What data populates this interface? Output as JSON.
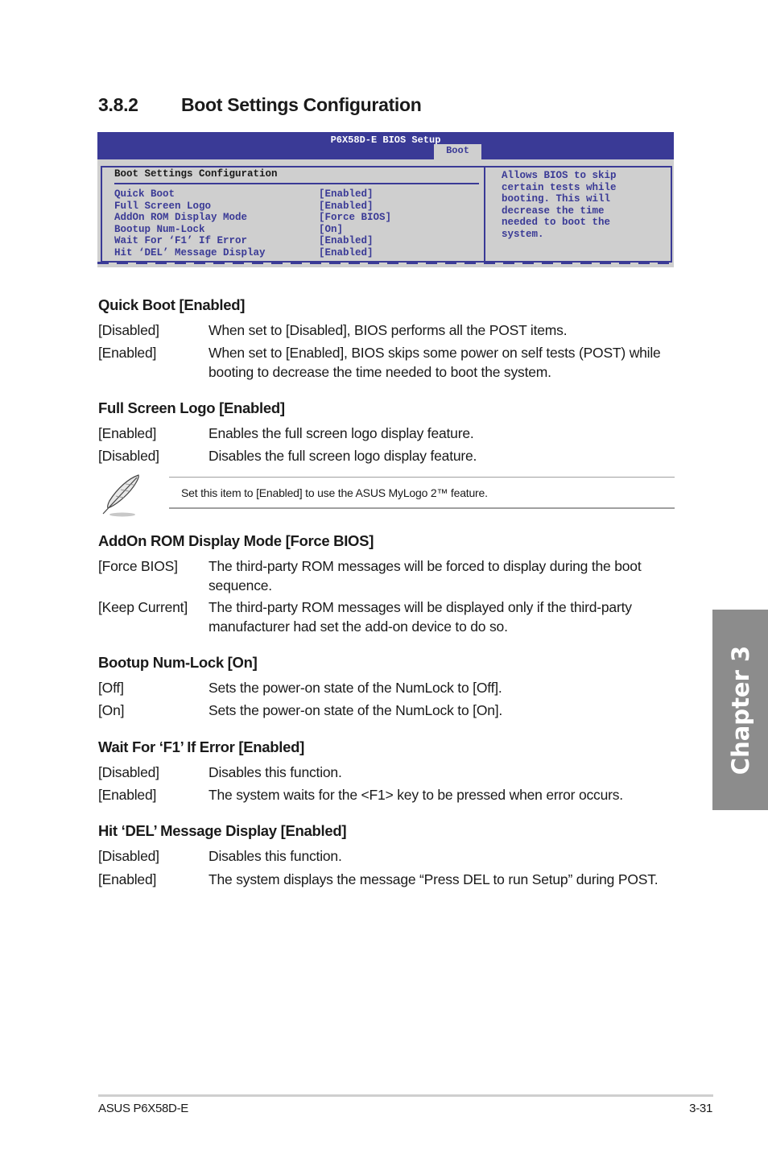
{
  "section": {
    "number": "3.8.2",
    "title": "Boot Settings Configuration"
  },
  "bios": {
    "title": "P6X58D-E BIOS Setup",
    "active_tab": "Boot",
    "panel_title": "Boot Settings Configuration",
    "items": [
      {
        "label": "Quick Boot",
        "value": "[Enabled]"
      },
      {
        "label": "Full Screen Logo",
        "value": "[Enabled]"
      },
      {
        "label": "AddOn ROM Display Mode",
        "value": "[Force BIOS]"
      },
      {
        "label": "Bootup Num-Lock",
        "value": "[On]"
      },
      {
        "label": "Wait For ‘F1’ If Error",
        "value": "[Enabled]"
      },
      {
        "label": "Hit ‘DEL’ Message Display",
        "value": "[Enabled]"
      }
    ],
    "help_lines": [
      "Allows BIOS to skip",
      "certain tests while",
      "booting. This will",
      "decrease the time",
      "needed to boot the",
      "system."
    ]
  },
  "descriptions": [
    {
      "heading": "Quick Boot [Enabled]",
      "options": [
        {
          "opt": "[Disabled]",
          "desc": "When set to [Disabled], BIOS performs all the POST items."
        },
        {
          "opt": "[Enabled]",
          "desc": "When set to [Enabled], BIOS skips some power on self tests (POST) while booting to decrease the time needed to boot the system."
        }
      ]
    },
    {
      "heading": "Full Screen Logo [Enabled]",
      "options": [
        {
          "opt": "[Enabled]",
          "desc": "Enables the full screen logo display feature."
        },
        {
          "opt": "[Disabled]",
          "desc": "Disables the full screen logo display feature."
        }
      ]
    },
    {
      "heading": "AddOn ROM Display Mode [Force BIOS]",
      "options": [
        {
          "opt": "[Force BIOS]",
          "desc": "The third-party ROM messages will be forced to display during the boot sequence."
        },
        {
          "opt": "[Keep Current]",
          "desc": "The third-party ROM messages will be displayed only if the third-party manufacturer had set the add-on device to do so."
        }
      ]
    },
    {
      "heading": "Bootup Num-Lock [On]",
      "options": [
        {
          "opt": "[Off]",
          "desc": "Sets the power-on state of the NumLock to [Off]."
        },
        {
          "opt": "[On]",
          "desc": "Sets the power-on state of the NumLock to [On]."
        }
      ]
    },
    {
      "heading": "Wait For ‘F1’ If Error [Enabled]",
      "options": [
        {
          "opt": "[Disabled]",
          "desc": "Disables this function."
        },
        {
          "opt": "[Enabled]",
          "desc": "The system waits for the <F1> key to be pressed when error occurs."
        }
      ]
    },
    {
      "heading": "Hit ‘DEL’ Message Display [Enabled]",
      "options": [
        {
          "opt": "[Disabled]",
          "desc": "Disables this function."
        },
        {
          "opt": "[Enabled]",
          "desc": "The system displays the message “Press DEL to run Setup” during POST."
        }
      ]
    }
  ],
  "note": {
    "icon": "feather-pen-icon",
    "text": "Set this item to [Enabled] to use the ASUS MyLogo 2™ feature."
  },
  "chapter_tab": "Chapter 3",
  "footer": {
    "left": "ASUS P6X58D-E",
    "right": "3-31"
  }
}
